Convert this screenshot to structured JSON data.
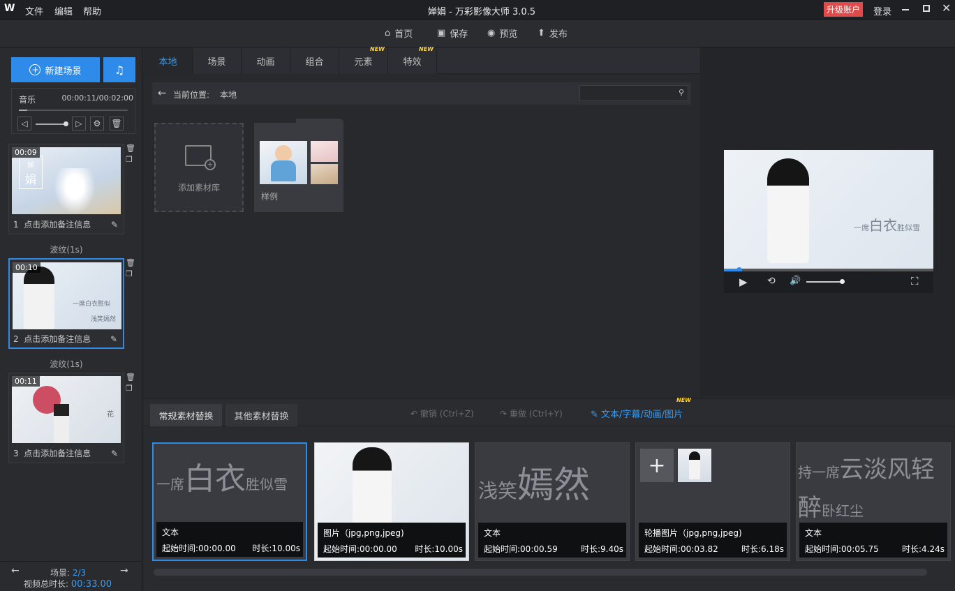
{
  "app": {
    "logo": "W",
    "title": "婵娟 - 万彩影像大师 3.0.5",
    "menus": [
      "文件",
      "编辑",
      "帮助"
    ],
    "upgrade": "升级账户",
    "login": "登录"
  },
  "toolbar": {
    "home": "首页",
    "save": "保存",
    "preview": "预览",
    "publish": "发布"
  },
  "left": {
    "new_scene": "新建场景",
    "music_label": "音乐",
    "music_time": "00:00:11/00:02:00",
    "scenes": [
      {
        "time": "00:09",
        "index": "1",
        "note": "点击添加备注信息",
        "text1": "婵",
        "text2": "娟"
      },
      {
        "time": "00:10",
        "index": "2",
        "note": "点击添加备注信息",
        "text1": "一席白衣胜似",
        "text2": "浅笑嫣然"
      },
      {
        "time": "00:11",
        "index": "3",
        "note": "点击添加备注信息",
        "text1": "",
        "text2": "花"
      }
    ],
    "transitions": [
      "波纹(1s)",
      "波纹(1s)"
    ],
    "footer_label": "场景:",
    "footer_value": "2/3",
    "total_label": "视频总时长:",
    "total_value": "00:33.00"
  },
  "library": {
    "tabs": [
      "本地",
      "场景",
      "动画",
      "组合",
      "元素",
      "特效"
    ],
    "new_badge": "NEW",
    "location_label": "当前位置:",
    "location_value": "本地",
    "search_placeholder": "",
    "add_label": "添加素材库",
    "example_label": "样例"
  },
  "bottom": {
    "tab_regular": "常规素材替换",
    "tab_other": "其他素材替换",
    "undo": "撤销 (Ctrl+Z)",
    "redo": "重做 (Ctrl+Y)",
    "text_link": "文本/字幕/动画/图片",
    "new_badge": "NEW",
    "cards": [
      {
        "big": "白衣",
        "pre": "一席",
        "post": "胜似雪",
        "type": "文本",
        "start": "起始时间:00:00.00",
        "dur": "时长:10.00s"
      },
      {
        "type": "图片（jpg,png,jpeg)",
        "start": "起始时间:00:00.00",
        "dur": "时长:10.00s"
      },
      {
        "pre": "浅笑",
        "big": "嫣然",
        "type": "文本",
        "start": "起始时间:00:00.59",
        "dur": "时长:9.40s"
      },
      {
        "type": "轮播图片（jpg,png,jpeg)",
        "start": "起始时间:00:03.82",
        "dur": "时长:6.18s"
      },
      {
        "line1a": "持一席",
        "line1b": "云淡风轻",
        "line2a": "醉",
        "line2b": "卧红尘",
        "type": "文本",
        "start": "起始时间:00:05.75",
        "dur": "时长:4.24s"
      }
    ]
  },
  "preview": {
    "caption_small1": "一席",
    "caption_big": "白衣",
    "caption_small2": "胜似雪"
  },
  "colors": {
    "accent": "#2f8bea",
    "upgrade": "#e04a4a"
  }
}
